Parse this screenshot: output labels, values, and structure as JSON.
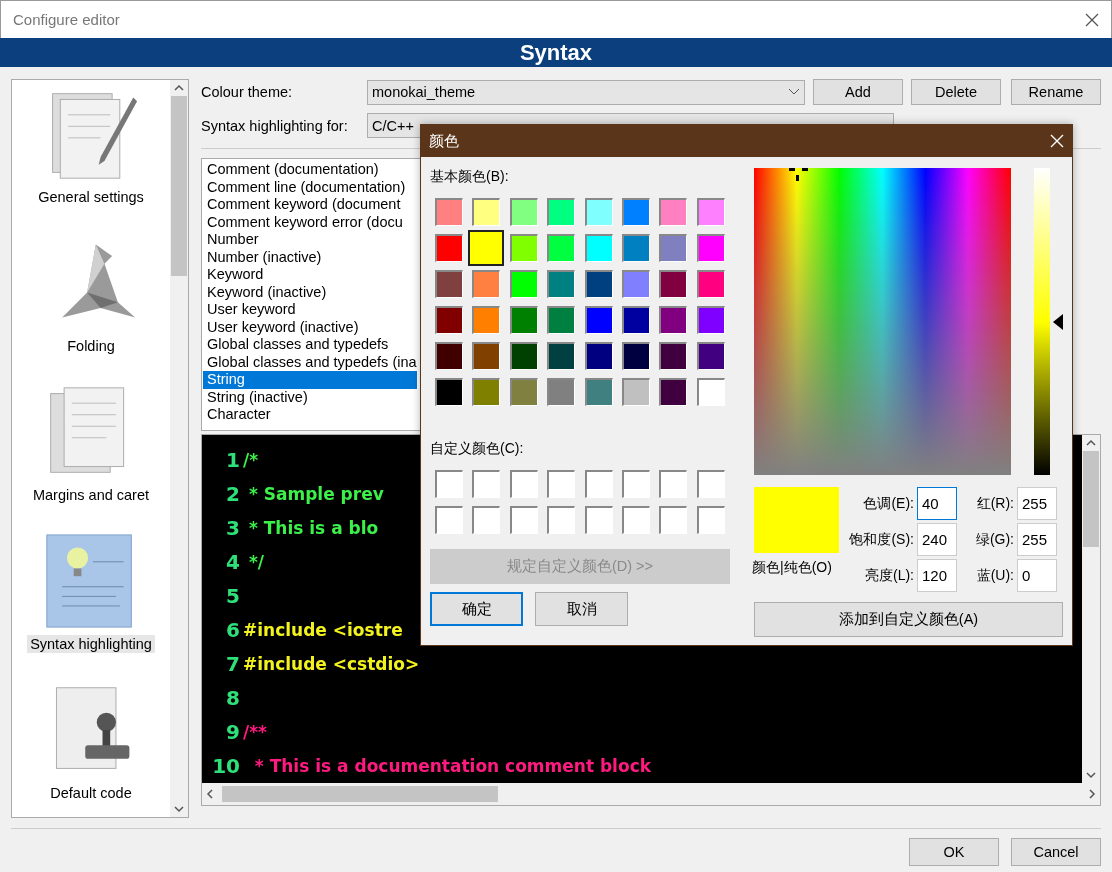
{
  "window": {
    "title": "Configure editor"
  },
  "header": {
    "title": "Syntax"
  },
  "sidebar": {
    "items": [
      {
        "label": "General settings",
        "kind": "pen",
        "selected": false
      },
      {
        "label": "Folding",
        "kind": "bird",
        "selected": false
      },
      {
        "label": "Margins and caret",
        "kind": "pages",
        "selected": false
      },
      {
        "label": "Syntax highlighting",
        "kind": "bulb",
        "selected": true
      },
      {
        "label": "Default code",
        "kind": "stamp",
        "selected": false
      }
    ]
  },
  "colour_theme": {
    "label": "Colour theme:",
    "value": "monokai_theme"
  },
  "theme_buttons": [
    "Add",
    "Delete",
    "Rename"
  ],
  "syntax_for": {
    "label": "Syntax highlighting for:",
    "value": "C/C++"
  },
  "styles_list": {
    "items": [
      {
        "label": "Comment (documentation)",
        "selected": false
      },
      {
        "label": "Comment line (documentation)",
        "selected": false
      },
      {
        "label": "Comment keyword (document",
        "selected": false
      },
      {
        "label": "Comment keyword error (docu",
        "selected": false
      },
      {
        "label": "Number",
        "selected": false
      },
      {
        "label": "Number (inactive)",
        "selected": false
      },
      {
        "label": "Keyword",
        "selected": false
      },
      {
        "label": "Keyword (inactive)",
        "selected": false
      },
      {
        "label": "User keyword",
        "selected": false
      },
      {
        "label": "User keyword (inactive)",
        "selected": false
      },
      {
        "label": "Global classes and typedefs",
        "selected": false
      },
      {
        "label": "Global classes and typedefs (ina",
        "selected": false
      },
      {
        "label": "String",
        "selected": true
      },
      {
        "label": "String (inactive)",
        "selected": false
      },
      {
        "label": "Character",
        "selected": false
      }
    ]
  },
  "editor": {
    "lines": [
      {
        "number": "1",
        "text": "/*",
        "kind": "comment"
      },
      {
        "number": "2",
        "text": " * Sample prev",
        "kind": "comment"
      },
      {
        "number": "3",
        "text": " * This is a blo",
        "kind": "comment"
      },
      {
        "number": "4",
        "text": " */",
        "kind": "comment"
      },
      {
        "number": "5"
      },
      {
        "number": "6",
        "text": "#include <iostre",
        "kind": "preprocessor"
      },
      {
        "number": "7",
        "text": "#include <cstdio>",
        "kind": "preprocessor"
      },
      {
        "number": "8"
      },
      {
        "number": "9",
        "text": "/**",
        "kind": "doc"
      },
      {
        "number": "10",
        "text": "  * This is a documentation comment block",
        "kind": "doc"
      }
    ]
  },
  "footer_buttons": [
    "OK",
    "Cancel"
  ],
  "color_dialog": {
    "title": "颜色",
    "basic_label": "基本颜色(B):",
    "basic_colors": [
      {
        "color": "#ff8080",
        "selected": false
      },
      {
        "color": "#ffff80",
        "selected": false
      },
      {
        "color": "#80ff80",
        "selected": false
      },
      {
        "color": "#00ff80",
        "selected": false
      },
      {
        "color": "#80ffff",
        "selected": false
      },
      {
        "color": "#0080ff",
        "selected": false
      },
      {
        "color": "#ff80c0",
        "selected": false
      },
      {
        "color": "#ff80ff",
        "selected": false
      },
      {
        "color": "#ff0000",
        "selected": false
      },
      {
        "color": "#ffff00",
        "selected": true
      },
      {
        "color": "#80ff00",
        "selected": false
      },
      {
        "color": "#00ff40",
        "selected": false
      },
      {
        "color": "#00ffff",
        "selected": false
      },
      {
        "color": "#0080c0",
        "selected": false
      },
      {
        "color": "#8080c0",
        "selected": false
      },
      {
        "color": "#ff00ff",
        "selected": false
      },
      {
        "color": "#804040",
        "selected": false
      },
      {
        "color": "#ff8040",
        "selected": false
      },
      {
        "color": "#00ff00",
        "selected": false
      },
      {
        "color": "#008080",
        "selected": false
      },
      {
        "color": "#004080",
        "selected": false
      },
      {
        "color": "#8080ff",
        "selected": false
      },
      {
        "color": "#800040",
        "selected": false
      },
      {
        "color": "#ff0080",
        "selected": false
      },
      {
        "color": "#800000",
        "selected": false
      },
      {
        "color": "#ff8000",
        "selected": false
      },
      {
        "color": "#008000",
        "selected": false
      },
      {
        "color": "#008040",
        "selected": false
      },
      {
        "color": "#0000ff",
        "selected": false
      },
      {
        "color": "#0000a0",
        "selected": false
      },
      {
        "color": "#800080",
        "selected": false
      },
      {
        "color": "#8000ff",
        "selected": false
      },
      {
        "color": "#400000",
        "selected": false
      },
      {
        "color": "#804000",
        "selected": false
      },
      {
        "color": "#004000",
        "selected": false
      },
      {
        "color": "#004040",
        "selected": false
      },
      {
        "color": "#000080",
        "selected": false
      },
      {
        "color": "#000040",
        "selected": false
      },
      {
        "color": "#400040",
        "selected": false
      },
      {
        "color": "#400080",
        "selected": false
      },
      {
        "color": "#000000",
        "selected": false
      },
      {
        "color": "#808000",
        "selected": false
      },
      {
        "color": "#808040",
        "selected": false
      },
      {
        "color": "#808080",
        "selected": false
      },
      {
        "color": "#408080",
        "selected": false
      },
      {
        "color": "#c0c0c0",
        "selected": false
      },
      {
        "color": "#400040",
        "selected": false
      },
      {
        "color": "#ffffff",
        "selected": false
      }
    ],
    "custom_label": "自定义颜色(C):",
    "custom_colors": [
      {
        "color": "#ffffff"
      },
      {
        "color": "#ffffff"
      },
      {
        "color": "#ffffff"
      },
      {
        "color": "#ffffff"
      },
      {
        "color": "#ffffff"
      },
      {
        "color": "#ffffff"
      },
      {
        "color": "#ffffff"
      },
      {
        "color": "#ffffff"
      },
      {
        "color": "#ffffff"
      },
      {
        "color": "#ffffff"
      },
      {
        "color": "#ffffff"
      },
      {
        "color": "#ffffff"
      },
      {
        "color": "#ffffff"
      },
      {
        "color": "#ffffff"
      },
      {
        "color": "#ffffff"
      },
      {
        "color": "#ffffff"
      }
    ],
    "define_button": {
      "label": "规定自定义颜色(D) >>",
      "disabled": true
    },
    "ok_button": {
      "label": "确定",
      "default": true
    },
    "cancel_button": {
      "label": "取消",
      "default": false
    },
    "luminance": {
      "level": 0.5
    },
    "preview": {
      "color": "#ffff00",
      "label": "颜色|纯色(O)"
    },
    "fields": [
      {
        "label": "色调(E):",
        "value": "40",
        "focused": true
      },
      {
        "label": "红(R):",
        "value": "255",
        "focused": false
      },
      {
        "label": "饱和度(S):",
        "value": "240",
        "focused": false
      },
      {
        "label": "绿(G):",
        "value": "255",
        "focused": false
      },
      {
        "label": "亮度(L):",
        "value": "120",
        "focused": false
      },
      {
        "label": "蓝(U):",
        "value": "0",
        "focused": false
      }
    ],
    "add_button": {
      "label": "添加到自定义颜色(A)"
    }
  }
}
